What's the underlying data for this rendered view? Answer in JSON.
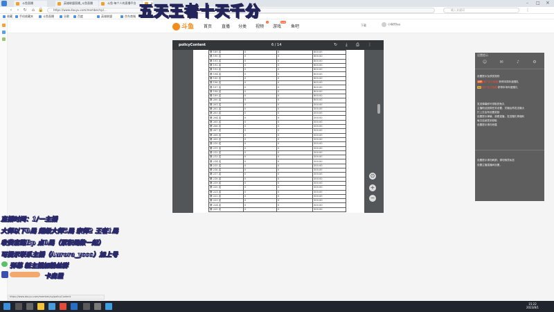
{
  "browser": {
    "tabs": [
      {
        "label": "斗鱼直播",
        "active": false
      },
      {
        "label": "英雄联盟直播_斗鱼直播",
        "active": false
      },
      {
        "label": "斗鱼-每个人的直播平台",
        "active": false
      },
      {
        "label": "policyContent",
        "active": true
      }
    ],
    "address": "https://www.douyu.com/member/cp/...",
    "search_placeholder": "输入关键词",
    "bookmarks": [
      "收藏",
      "手机收藏夹",
      "斗鱼直播",
      "谷歌",
      "百度",
      "英雄联盟",
      "京东商城"
    ]
  },
  "overlay": {
    "title": "五天王者十天千分",
    "lines": [
      "直播时间：1/一主播",
      "大师以下9局 超级大师5局 宗师2 王者1局",
      "收费套路Bp 点0局（累积局数一起）",
      "可提示联系主播（Aurora_yccc）加上号",
      "弹幕 新主播加粉丝群",
      "卡房里"
    ]
  },
  "site": {
    "logo": "斗鱼",
    "nav": [
      {
        "label": "首页",
        "hot": ""
      },
      {
        "label": "直播",
        "hot": ""
      },
      {
        "label": "分类",
        "hot": ""
      },
      {
        "label": "视频",
        "hot": "•"
      },
      {
        "label": "游戏",
        "hot": "new"
      },
      {
        "label": "鱼吧",
        "hot": ""
      }
    ],
    "header_link": "下载",
    "username": "小鱼99aa"
  },
  "pdf": {
    "title": "policyContent",
    "page_indicator": "6 / 14",
    "rows": [
      {
        "name": "第 189 名",
        "a": "0",
        "b": "0",
        "c": "800.00"
      },
      {
        "name": "第 190 名",
        "a": "0",
        "b": "0",
        "c": "800.00"
      },
      {
        "name": "第 191 名",
        "a": "0",
        "b": "0",
        "c": "800.00"
      },
      {
        "name": "第 192 名",
        "a": "0",
        "b": "0",
        "c": "800.00"
      },
      {
        "name": "第 193 名",
        "a": "0",
        "b": "0",
        "c": "800.00"
      },
      {
        "name": "第 194 名",
        "a": "0",
        "b": "0",
        "c": "800.00"
      },
      {
        "name": "第 195 名",
        "a": "0",
        "b": "0",
        "c": "800.00"
      },
      {
        "name": "第 196 名",
        "a": "0",
        "b": "0",
        "c": "800.00"
      },
      {
        "name": "第 197 名",
        "a": "0",
        "b": "0",
        "c": "800.00"
      },
      {
        "name": "第 198 名",
        "a": "0",
        "b": "0",
        "c": "800.00"
      },
      {
        "name": "第 199 名",
        "a": "0",
        "b": "0",
        "c": "800.00"
      },
      {
        "name": "第 200 名",
        "a": "0",
        "b": "0",
        "c": "800.00"
      },
      {
        "name": "第 201 名",
        "a": "0",
        "b": "0",
        "c": "500.00"
      },
      {
        "name": "第 202 名",
        "a": "0",
        "b": "0",
        "c": "500.00"
      },
      {
        "name": "第 203 名",
        "a": "0",
        "b": "0",
        "c": "500.00"
      },
      {
        "name": "第 204 名",
        "a": "0",
        "b": "0",
        "c": "500.00"
      },
      {
        "name": "第 205 名",
        "a": "0",
        "b": "0",
        "c": "500.00"
      },
      {
        "name": "第 206 名",
        "a": "0",
        "b": "0",
        "c": "500.00"
      },
      {
        "name": "第 207 名",
        "a": "0",
        "b": "0",
        "c": "500.00"
      },
      {
        "name": "第 208 名",
        "a": "0",
        "b": "0",
        "c": "500.00"
      },
      {
        "name": "第 209 名",
        "a": "0",
        "b": "0",
        "c": "500.00"
      },
      {
        "name": "第 210 名",
        "a": "0",
        "b": "0",
        "c": "500.00"
      },
      {
        "name": "第 211 名",
        "a": "0",
        "b": "0",
        "c": "500.00"
      },
      {
        "name": "第 212 名",
        "a": "0",
        "b": "0",
        "c": "500.00"
      },
      {
        "name": "第 213 名",
        "a": "0",
        "b": "0",
        "c": "500.00"
      },
      {
        "name": "第 214 名",
        "a": "0",
        "b": "0",
        "c": "500.00"
      },
      {
        "name": "第 215 名",
        "a": "0",
        "b": "0",
        "c": "500.00"
      },
      {
        "name": "第 216 名",
        "a": "0",
        "b": "0",
        "c": "500.00"
      },
      {
        "name": "第 217 名",
        "a": "0",
        "b": "0",
        "c": "500.00"
      },
      {
        "name": "第 218 名",
        "a": "0",
        "b": "0",
        "c": "500.00"
      },
      {
        "name": "第 219 名",
        "a": "0",
        "b": "0",
        "c": "500.00"
      },
      {
        "name": "第 220 名",
        "a": "0",
        "b": "0",
        "c": "500.00"
      },
      {
        "name": "第 221 名",
        "a": "0",
        "b": "0",
        "c": "500.00"
      },
      {
        "name": "第 222 名",
        "a": "0",
        "b": "0",
        "c": "500.00"
      },
      {
        "name": "第 223 名",
        "a": "0",
        "b": "0",
        "c": "500.00"
      },
      {
        "name": "第 224 名",
        "a": "0",
        "b": "0",
        "c": "500.00"
      },
      {
        "name": "第 225 名",
        "a": "0",
        "b": "0",
        "c": "500.00"
      }
    ]
  },
  "panel": {
    "title": "设置提示",
    "icons": [
      "person-icon",
      "gift-icon",
      "bell-icon",
      "gear-icon"
    ],
    "lines": [
      {
        "text": "设置提示及获奖规则",
        "badge": "",
        "red": ""
      },
      {
        "text": "获得本周年度赠礼",
        "badge": "VIP",
        "red": "用户名已隐藏"
      },
      {
        "text": "获得本场年度赠礼",
        "badge": "LV",
        "red": "用户名已隐藏"
      },
      {
        "text": "发送弹幕即可领取铁鱼丸",
        "badge": "",
        "red": ""
      },
      {
        "text": "主播粉丝团周任务设置，关播后再发送最大",
        "badge": "",
        "red": ""
      },
      {
        "text": "打上去会有设置奖励",
        "badge": "",
        "red": ""
      },
      {
        "text": "设置提示弹幕、观看直播，发送赠礼等福利",
        "badge": "",
        "red": ""
      },
      {
        "text": "每日连续签到领取",
        "badge": "",
        "red": ""
      },
      {
        "text": "设置提示请勿泄露",
        "badge": "",
        "red": ""
      },
      {
        "text": "设置提示请勿刷屏；请勿随意私信",
        "badge": "",
        "red": ""
      },
      {
        "text": "设置主播直播间设置，",
        "badge": "",
        "red": ""
      }
    ]
  },
  "status_url": "https://www.douyu.com/member/cp/policyContent",
  "taskbar": {
    "time": "15:22",
    "date": "2023/8/1"
  },
  "colors": {
    "accent": "#f28c1a",
    "pdf_toolbar": "#323639",
    "taskbar": "#20242c"
  }
}
